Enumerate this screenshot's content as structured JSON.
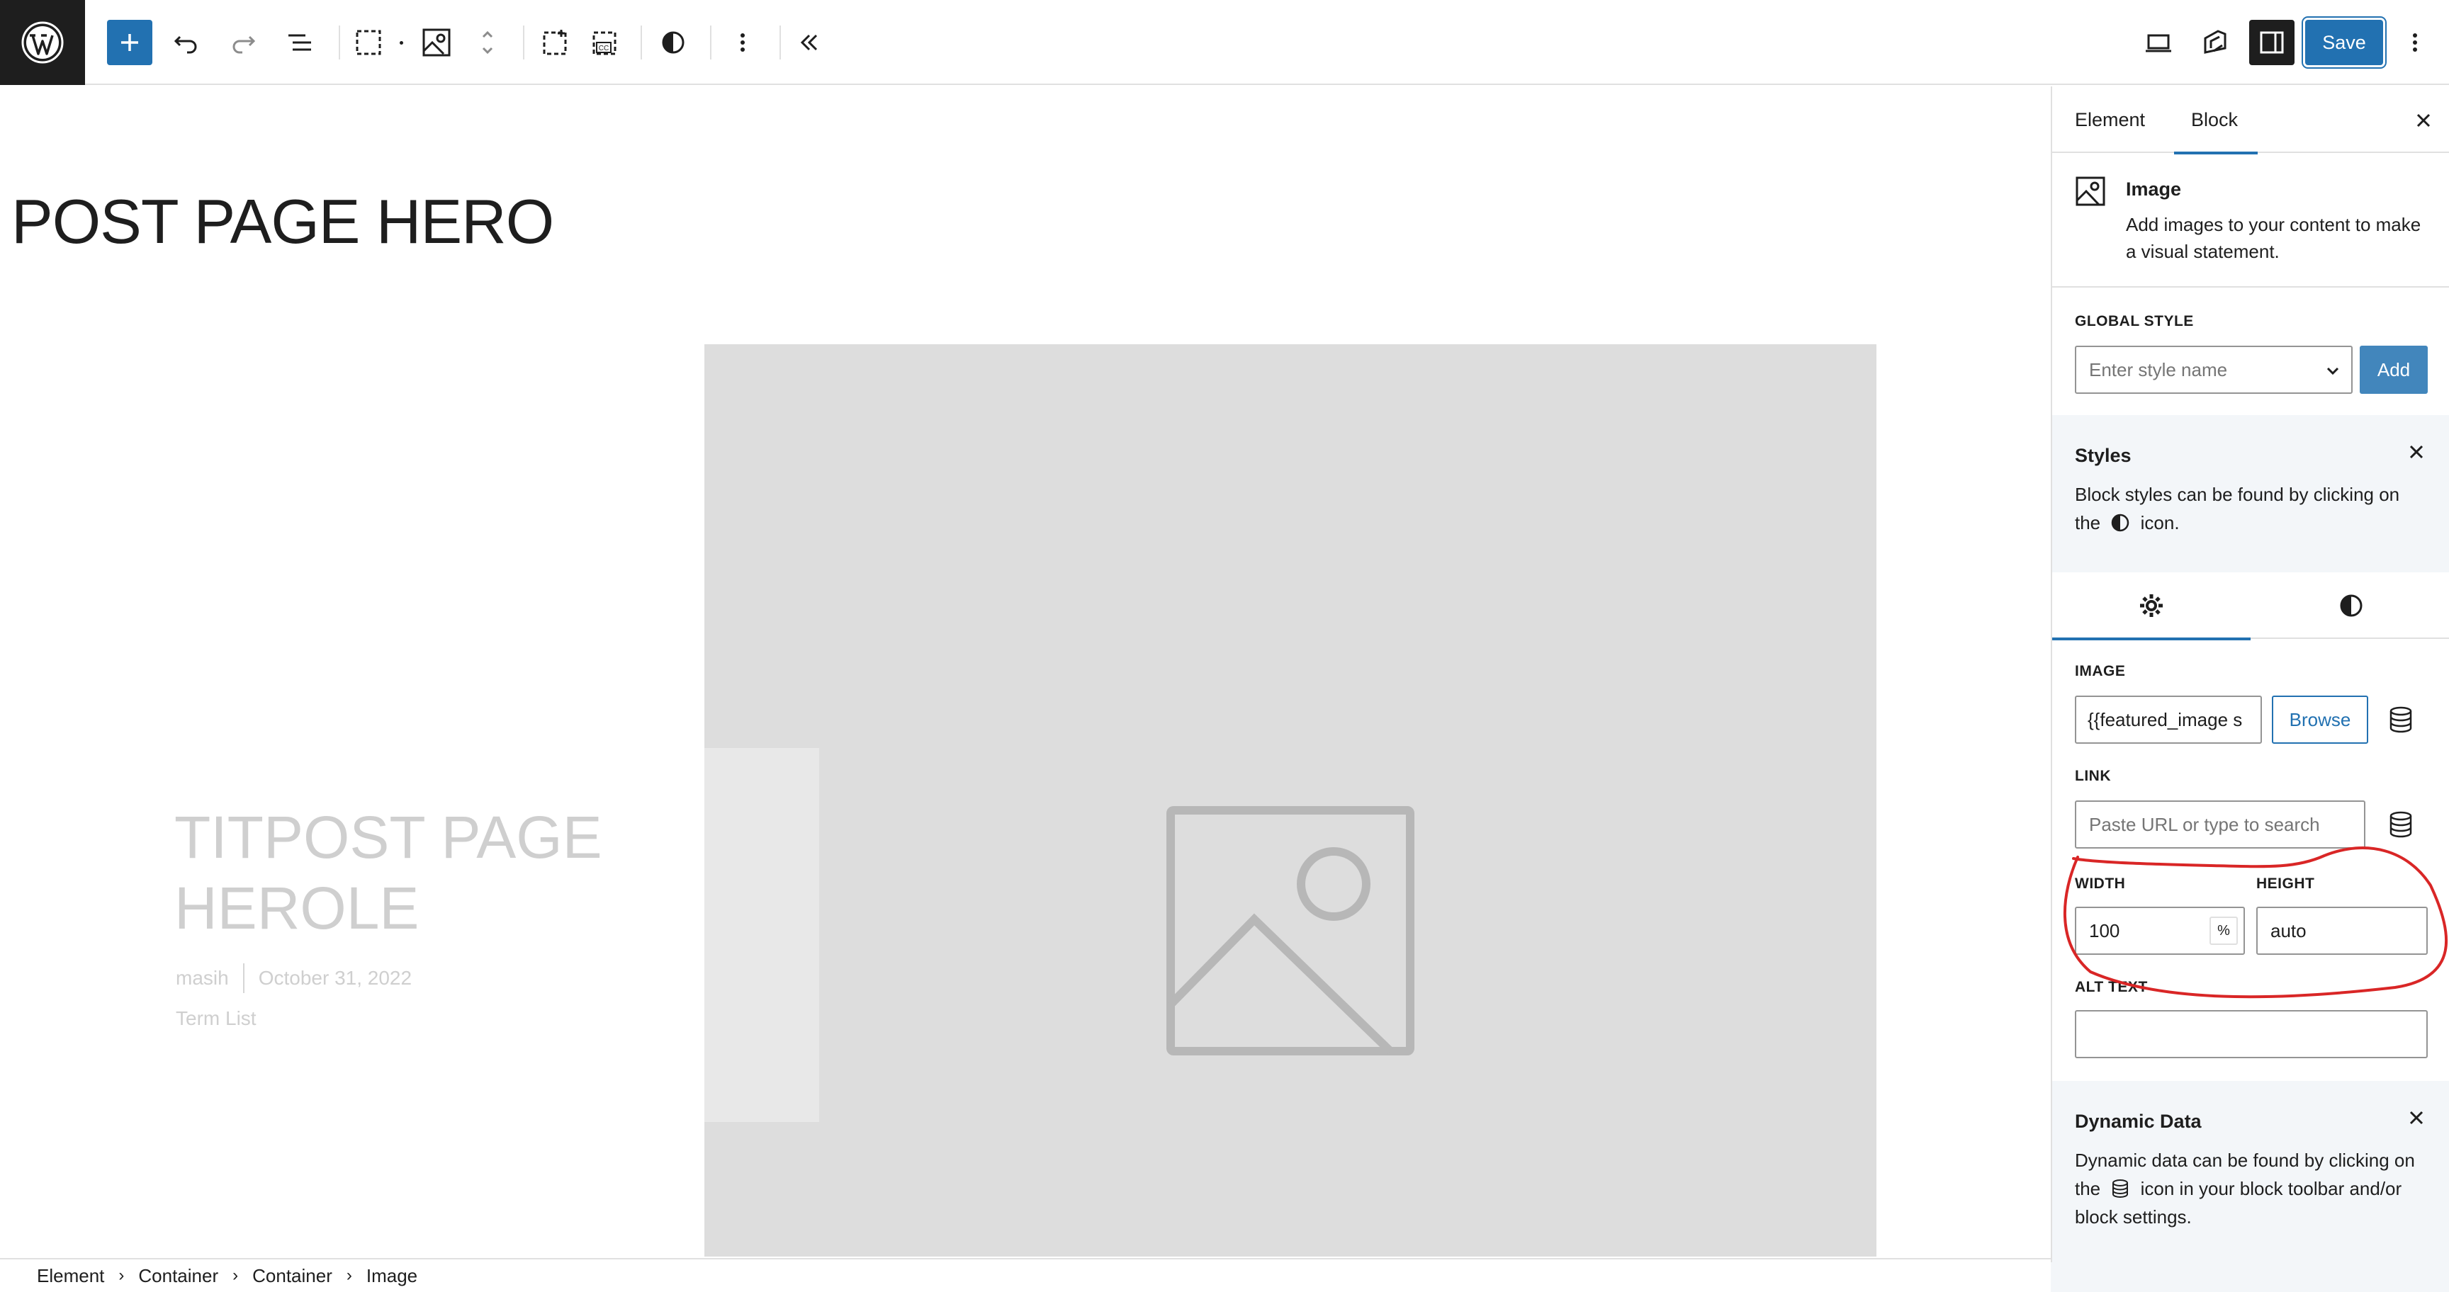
{
  "app": {
    "name": "WordPress Block Editor",
    "logo_icon": "wordpress-logo-icon"
  },
  "toolbar": {
    "add_icon": "plus-icon",
    "undo_icon": "undo-icon",
    "redo_icon": "redo-icon",
    "list_view_icon": "list-view-icon",
    "save_label": "Save",
    "accent_color": "#2271b1"
  },
  "canvas": {
    "page_title": "POST PAGE HERO",
    "ghost_title": "TITPOST PAGE HEROLE",
    "author": "masih",
    "date": "October 31, 2022",
    "terms": "Term List",
    "image_placeholder_color": "#dddddd"
  },
  "sidebar": {
    "tabs": [
      {
        "label": "Element"
      },
      {
        "label": "Block"
      }
    ],
    "active_tab": "Block",
    "block": {
      "name": "Image",
      "description": "Add images to your content to make a visual statement."
    },
    "global_style": {
      "label": "GLOBAL STYLE",
      "placeholder": "Enter style name",
      "add_label": "Add"
    },
    "styles_panel": {
      "title": "Styles",
      "text_before": "Block styles can be found by clicking on the",
      "text_after": "icon."
    },
    "image": {
      "label": "IMAGE",
      "value": "{{featured_image s",
      "browse_label": "Browse"
    },
    "link": {
      "label": "LINK",
      "placeholder": "Paste URL or type to search"
    },
    "width": {
      "label": "WIDTH",
      "value": "100",
      "unit": "%"
    },
    "height": {
      "label": "HEIGHT",
      "value": "auto"
    },
    "alt_text": {
      "label": "ALT TEXT",
      "value": ""
    },
    "dynamic_panel": {
      "title": "Dynamic Data",
      "text_before": "Dynamic data can be found by clicking on the",
      "text_after": "icon in your block toolbar and/or block settings."
    }
  },
  "breadcrumb": [
    "Element",
    "Container",
    "Container",
    "Image"
  ],
  "annotation": {
    "shape": "hand-drawn red ellipse",
    "color": "#d92626"
  }
}
